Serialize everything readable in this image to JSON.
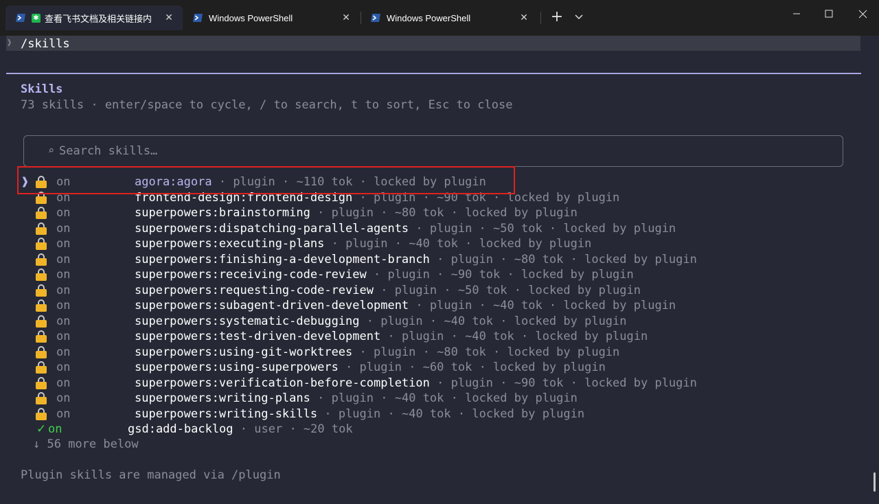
{
  "tabs": [
    {
      "title": "查看飞书文档及相关链接内",
      "active": true,
      "badge": "✱"
    },
    {
      "title": "Windows PowerShell",
      "active": false
    },
    {
      "title": "Windows PowerShell",
      "active": false
    }
  ],
  "icons": {
    "tab_close": "✕",
    "new_tab": "+",
    "dropdown": "chevron-down-icon",
    "cursor": "❱",
    "prompt_chevron": "❱",
    "search": "⌕",
    "check": "✓",
    "arrow_down": "↓"
  },
  "colors": {
    "accent": "#b7b5f0",
    "lock": "#f0b429",
    "check": "#3fd14d",
    "highlight": "#e02020"
  },
  "prompt": {
    "command": "/skills"
  },
  "panel": {
    "title": "Skills",
    "hint": "73 skills · enter/space to cycle, / to search, t to sort, Esc to close",
    "search_placeholder": "Search skills…",
    "more_below": "56 more below",
    "footer": "Plugin skills are managed via /plugin"
  },
  "skills": [
    {
      "state": "on",
      "name": "agora:agora",
      "source": "plugin",
      "tokens": "~110 tok",
      "note": "locked by plugin",
      "locked": true,
      "selected": true
    },
    {
      "state": "on",
      "name": "frontend-design:frontend-design",
      "source": "plugin",
      "tokens": "~90 tok",
      "note": "locked by plugin",
      "locked": true
    },
    {
      "state": "on",
      "name": "superpowers:brainstorming",
      "source": "plugin",
      "tokens": "~80 tok",
      "note": "locked by plugin",
      "locked": true
    },
    {
      "state": "on",
      "name": "superpowers:dispatching-parallel-agents",
      "source": "plugin",
      "tokens": "~50 tok",
      "note": "locked by plugin",
      "locked": true
    },
    {
      "state": "on",
      "name": "superpowers:executing-plans",
      "source": "plugin",
      "tokens": "~40 tok",
      "note": "locked by plugin",
      "locked": true
    },
    {
      "state": "on",
      "name": "superpowers:finishing-a-development-branch",
      "source": "plugin",
      "tokens": "~80 tok",
      "note": "locked by plugin",
      "locked": true
    },
    {
      "state": "on",
      "name": "superpowers:receiving-code-review",
      "source": "plugin",
      "tokens": "~90 tok",
      "note": "locked by plugin",
      "locked": true
    },
    {
      "state": "on",
      "name": "superpowers:requesting-code-review",
      "source": "plugin",
      "tokens": "~50 tok",
      "note": "locked by plugin",
      "locked": true
    },
    {
      "state": "on",
      "name": "superpowers:subagent-driven-development",
      "source": "plugin",
      "tokens": "~40 tok",
      "note": "locked by plugin",
      "locked": true
    },
    {
      "state": "on",
      "name": "superpowers:systematic-debugging",
      "source": "plugin",
      "tokens": "~40 tok",
      "note": "locked by plugin",
      "locked": true
    },
    {
      "state": "on",
      "name": "superpowers:test-driven-development",
      "source": "plugin",
      "tokens": "~40 tok",
      "note": "locked by plugin",
      "locked": true
    },
    {
      "state": "on",
      "name": "superpowers:using-git-worktrees",
      "source": "plugin",
      "tokens": "~80 tok",
      "note": "locked by plugin",
      "locked": true
    },
    {
      "state": "on",
      "name": "superpowers:using-superpowers",
      "source": "plugin",
      "tokens": "~60 tok",
      "note": "locked by plugin",
      "locked": true
    },
    {
      "state": "on",
      "name": "superpowers:verification-before-completion",
      "source": "plugin",
      "tokens": "~90 tok",
      "note": "locked by plugin",
      "locked": true
    },
    {
      "state": "on",
      "name": "superpowers:writing-plans",
      "source": "plugin",
      "tokens": "~40 tok",
      "note": "locked by plugin",
      "locked": true
    },
    {
      "state": "on",
      "name": "superpowers:writing-skills",
      "source": "plugin",
      "tokens": "~40 tok",
      "note": "locked by plugin",
      "locked": true
    },
    {
      "state": "on",
      "name": "gsd:add-backlog",
      "source": "user",
      "tokens": "~20 tok",
      "note": "",
      "locked": false
    }
  ]
}
